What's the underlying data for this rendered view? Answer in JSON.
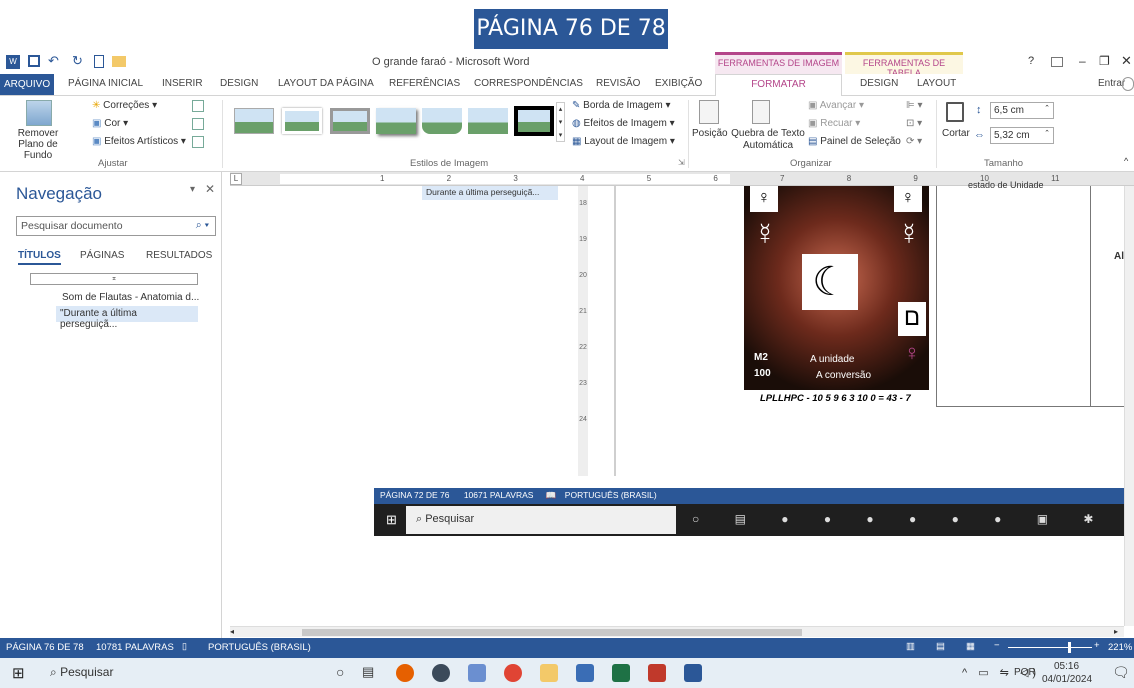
{
  "banner": {
    "text": "PÁGINA 76 DE 78"
  },
  "window": {
    "title": "O grande faraó - Microsoft Word",
    "context_image": "FERRAMENTAS DE IMAGEM",
    "context_table": "FERRAMENTAS DE TABELA",
    "help": "?",
    "signin": "Entrar"
  },
  "tabs": {
    "arquivo": "ARQUIVO",
    "inicial": "PÁGINA INICIAL",
    "inserir": "INSERIR",
    "design": "DESIGN",
    "layout_pagina": "LAYOUT DA PÁGINA",
    "referencias": "REFERÊNCIAS",
    "correspondencias": "CORRESPONDÊNCIAS",
    "revisao": "REVISÃO",
    "exibicao": "EXIBIÇÃO",
    "formatar": "FORMATAR",
    "design2": "DESIGN",
    "layout2": "LAYOUT"
  },
  "ribbon": {
    "remover_plano": "Remover Plano de Fundo",
    "correcoes": "Correções",
    "cor": "Cor",
    "efeitos_artisticos": "Efeitos Artísticos",
    "ajustar": "Ajustar",
    "estilos": "Estilos de Imagem",
    "borda": "Borda de Imagem",
    "efeitos": "Efeitos de Imagem",
    "layout_imagem": "Layout de Imagem",
    "posicao": "Posição",
    "quebra": "Quebra de Texto Automática",
    "avancar": "Avançar",
    "recuar": "Recuar",
    "painel": "Painel de Seleção",
    "organizar": "Organizar",
    "cortar": "Cortar",
    "altura": "6,5 cm",
    "largura": "5,32 cm",
    "tamanho": "Tamanho"
  },
  "nav": {
    "title": "Navegação",
    "search_placeholder": "Pesquisar documento",
    "tab_titulos": "TÍTULOS",
    "tab_paginas": "PÁGINAS",
    "tab_resultados": "RESULTADOS",
    "items": [
      "Som de Flautas - Anatomia d...",
      "\"Durante a última perseguiçã..."
    ]
  },
  "inner": {
    "nav_item": "Durante a última perseguiçã...",
    "status_page": "PÁGINA 72 DE 76",
    "status_words": "10671 PALAVRAS",
    "status_lang": "PORTUGUÊS (BRASIL)",
    "search": "Pesquisar",
    "card_m2": "M2",
    "card_100": "100",
    "card_unidade": "A unidade",
    "card_conversao": "A conversão",
    "card_caption": "LPLLHPC - 10 5 9 6 3 10 0 = 43 - 7",
    "side_text": "estado de Unidade",
    "side_text2": "Ale"
  },
  "status": {
    "page": "PÁGINA 76 DE 78",
    "words": "10781 PALAVRAS",
    "lang": "PORTUGUÊS (BRASIL)",
    "zoom": "221%"
  },
  "taskbar": {
    "search": "Pesquisar",
    "lang": "POR",
    "time": "05:16",
    "date": "04/01/2024"
  },
  "colors": {
    "word_blue": "#2b5797",
    "image_tools": "#b4468a",
    "table_tools": "#e0c84b"
  }
}
